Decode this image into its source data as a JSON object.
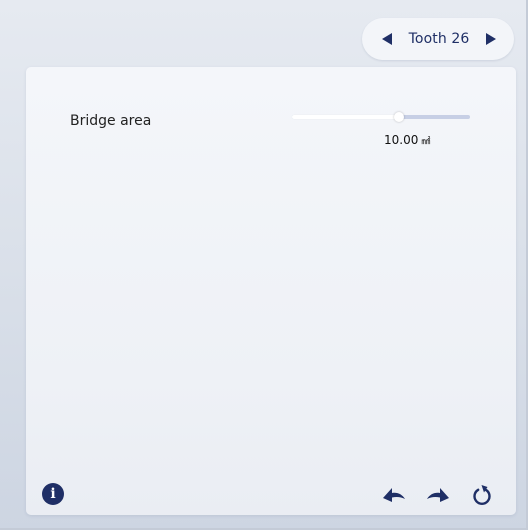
{
  "tooth_nav": {
    "label": "Tooth 26",
    "prev_icon": "left-triangle-icon",
    "next_icon": "right-triangle-icon"
  },
  "parameter": {
    "label": "Bridge area",
    "value": "10.00",
    "unit": "㎟",
    "slider_fraction": 0.6
  },
  "toolbar": {
    "info_glyph": "i",
    "info_icon": "info-icon",
    "undo_icon": "undo-icon",
    "redo_icon": "redo-icon",
    "reset_icon": "reset-icon"
  },
  "colors": {
    "accent": "#1f2f66",
    "panel": "#f0f3f8",
    "track": "#c7cfe5"
  }
}
